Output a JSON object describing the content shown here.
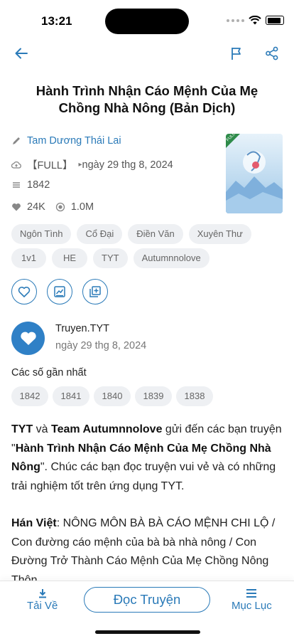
{
  "status": {
    "time": "13:21"
  },
  "book": {
    "title": "Hành Trình Nhận Cáo Mệnh Của Mẹ Chồng Nhà Nông (Bản Dịch)",
    "author": "Tam Dương Thái Lai",
    "status": "【FULL】",
    "updated": "ngày 29 thg 8, 2024",
    "chapters_count": "1842",
    "likes": "24K",
    "views": "1.0M",
    "cover_badge": "FULL"
  },
  "tags": [
    "Ngôn Tình",
    "Cổ Đại",
    "Điền Văn",
    "Xuyên Thư",
    "1v1",
    "HE",
    "TYT",
    "Autumnnolove"
  ],
  "poster": {
    "name": "Truyen.TYT",
    "date": "ngày 29 thg 8, 2024"
  },
  "recent": {
    "label": "Các số gần nhất",
    "chapters": [
      "1842",
      "1841",
      "1840",
      "1839",
      "1838"
    ]
  },
  "description": {
    "p1_a": "TYT",
    "p1_b": " và ",
    "p1_c": "Team Autumnnolove",
    "p1_d": " gửi đến các bạn truyện \"",
    "p1_e": "Hành Trình Nhận Cáo Mệnh Của Mẹ Chồng Nhà Nông",
    "p1_f": "\". Chúc các bạn đọc truyện vui vẻ và có những trải nghiệm tốt trên ứng dụng TYT.",
    "p2_a": "Hán Việt",
    "p2_b": ": NÔNG MÔN BÀ BÀ CÁO MỆNH CHI LỘ / Con đường cáo mệnh của bà bà nhà nông / Con Đường Trở Thành Cáo Mệnh Của Mẹ Chồng Nông Thôn"
  },
  "bottom_bar": {
    "download": "Tải Về",
    "read": "Đọc Truyện",
    "toc": "Mục Lục"
  },
  "colors": {
    "accent": "#2a7ab8",
    "chip_bg": "#eef0f3",
    "avatar": "#2f80c6"
  }
}
